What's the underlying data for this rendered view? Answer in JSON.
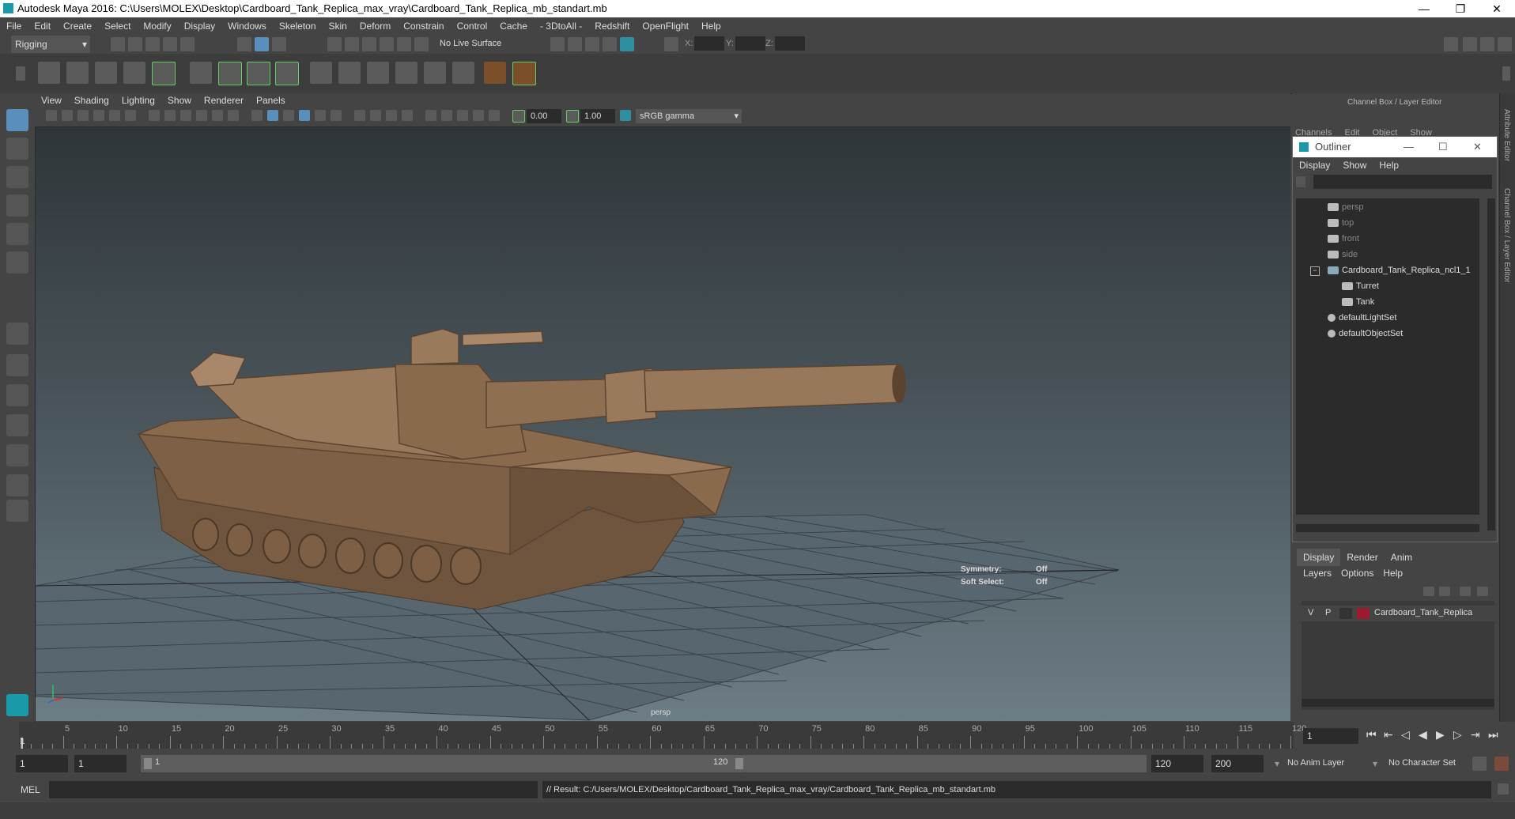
{
  "window": {
    "title": "Autodesk Maya 2016: C:\\Users\\MOLEX\\Desktop\\Cardboard_Tank_Replica_max_vray\\Cardboard_Tank_Replica_mb_standart.mb",
    "minimize": "—",
    "restore": "❐",
    "close": "✕"
  },
  "menubar": [
    "File",
    "Edit",
    "Create",
    "Select",
    "Modify",
    "Display",
    "Windows",
    "Skeleton",
    "Skin",
    "Deform",
    "Constrain",
    "Control",
    "Cache",
    "- 3DtoAll -",
    "Redshift",
    "OpenFlight",
    "Help"
  ],
  "status": {
    "mode": "Rigging",
    "live_surface": "No Live Surface",
    "x_label": "X:",
    "y_label": "Y:",
    "z_label": "Z:"
  },
  "panel": {
    "menus": [
      "View",
      "Shading",
      "Lighting",
      "Show",
      "Renderer",
      "Panels"
    ],
    "exposure": "0.00",
    "gamma": "1.00",
    "colorspace": "sRGB gamma"
  },
  "viewport": {
    "camera_label": "persp",
    "symmetry_label": "Symmetry:",
    "symmetry_value": "Off",
    "soft_select_label": "Soft Select:",
    "soft_select_value": "Off"
  },
  "channelbox": {
    "title": "Channel Box / Layer Editor",
    "menus": [
      "Channels",
      "Edit",
      "Object",
      "Show"
    ]
  },
  "outliner": {
    "title": "Outliner",
    "menus": [
      "Display",
      "Show",
      "Help"
    ],
    "items": [
      {
        "label": "persp",
        "icon": "camera-icon",
        "dim": true
      },
      {
        "label": "top",
        "icon": "camera-icon",
        "dim": true
      },
      {
        "label": "front",
        "icon": "camera-icon",
        "dim": true
      },
      {
        "label": "side",
        "icon": "camera-icon",
        "dim": true
      },
      {
        "label": "Cardboard_Tank_Replica_ncl1_1",
        "icon": "group-icon",
        "dim": false
      },
      {
        "label": "Turret",
        "icon": "mesh-icon",
        "dim": false
      },
      {
        "label": "Tank",
        "icon": "mesh-icon",
        "dim": false
      },
      {
        "label": "defaultLightSet",
        "icon": "set-icon",
        "dim": false
      },
      {
        "label": "defaultObjectSet",
        "icon": "set-icon",
        "dim": false
      }
    ]
  },
  "layer_editor": {
    "tabs": [
      "Display",
      "Render",
      "Anim"
    ],
    "menus": [
      "Layers",
      "Options",
      "Help"
    ],
    "layer": {
      "v": "V",
      "p": "P",
      "name": "Cardboard_Tank_Replica",
      "color": "#9b1a2e"
    }
  },
  "side_tabs": [
    "Attribute Editor",
    "Channel Box / Layer Editor"
  ],
  "timeline": {
    "ticks": [
      "5",
      "10",
      "15",
      "20",
      "25",
      "30",
      "35",
      "40",
      "45",
      "50",
      "55",
      "60",
      "65",
      "70",
      "75",
      "80",
      "85",
      "90",
      "95",
      "100",
      "105",
      "110",
      "115",
      "120"
    ],
    "start_marker": "1",
    "current_frame": "1"
  },
  "range": {
    "start": "1",
    "playback_start": "1",
    "slider_start": "1",
    "slider_end": "120",
    "playback_end": "120",
    "end": "200",
    "anim_layer": "No Anim Layer",
    "character_set": "No Character Set"
  },
  "cmdline": {
    "lang": "MEL",
    "result": "// Result: C:/Users/MOLEX/Desktop/Cardboard_Tank_Replica_max_vray/Cardboard_Tank_Replica_mb_standart.mb"
  },
  "colors": {
    "accent_blue": "#5a8fbb",
    "cardboard": "#8a6a4d",
    "layer_red": "#9b1a2e"
  }
}
